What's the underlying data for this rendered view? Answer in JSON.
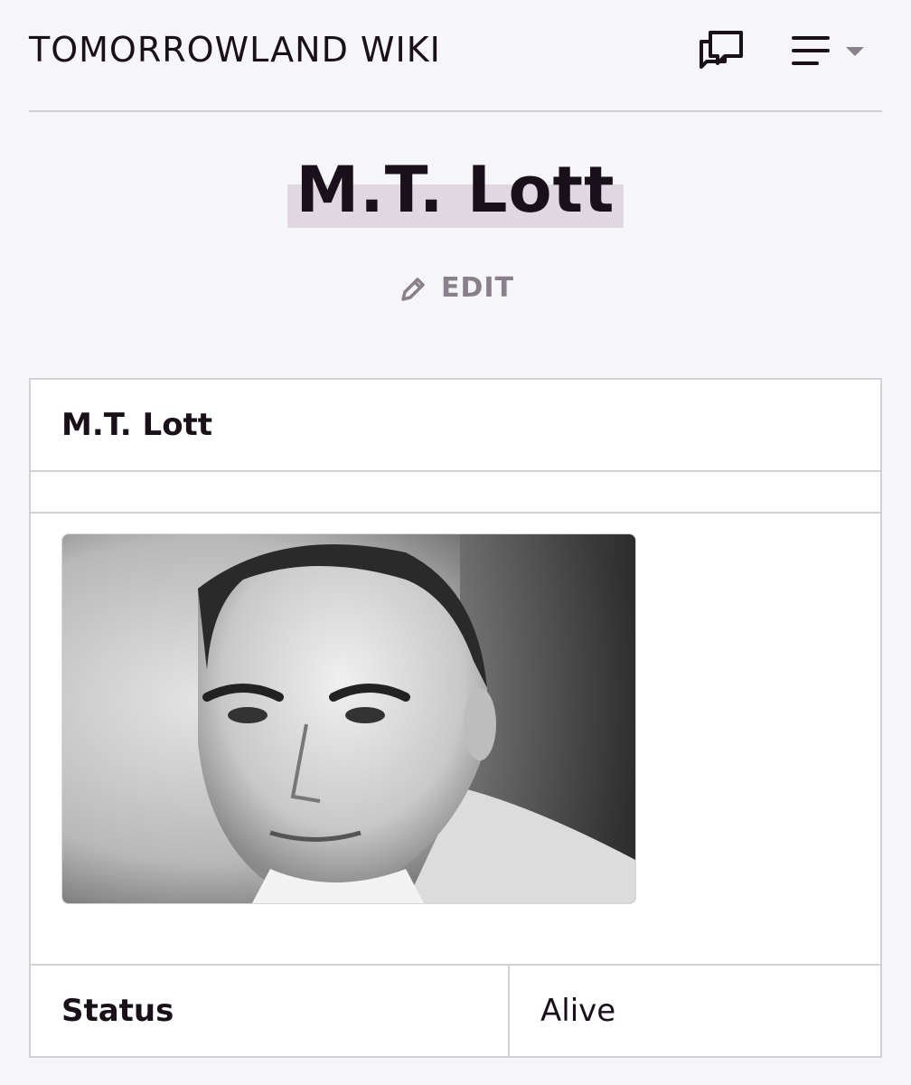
{
  "header": {
    "site_title": "TOMORROWLAND WIKI",
    "discussions_icon": "speech-bubbles-icon",
    "menu_icon": "hamburger-menu-icon",
    "menu_caret_icon": "caret-down-icon"
  },
  "page": {
    "title": "M.T. Lott",
    "edit_label": "EDIT",
    "edit_icon": "pencil-icon"
  },
  "infobox": {
    "title": "M.T. Lott",
    "image_description": "portrait-image",
    "fields": [
      {
        "label": "Status",
        "value": "Alive"
      }
    ]
  },
  "colors": {
    "text": "#1a1019",
    "muted": "#8a808b",
    "border": "#d4d0d5",
    "highlight": "#e0d8e0",
    "background": "#f6f5f7"
  }
}
